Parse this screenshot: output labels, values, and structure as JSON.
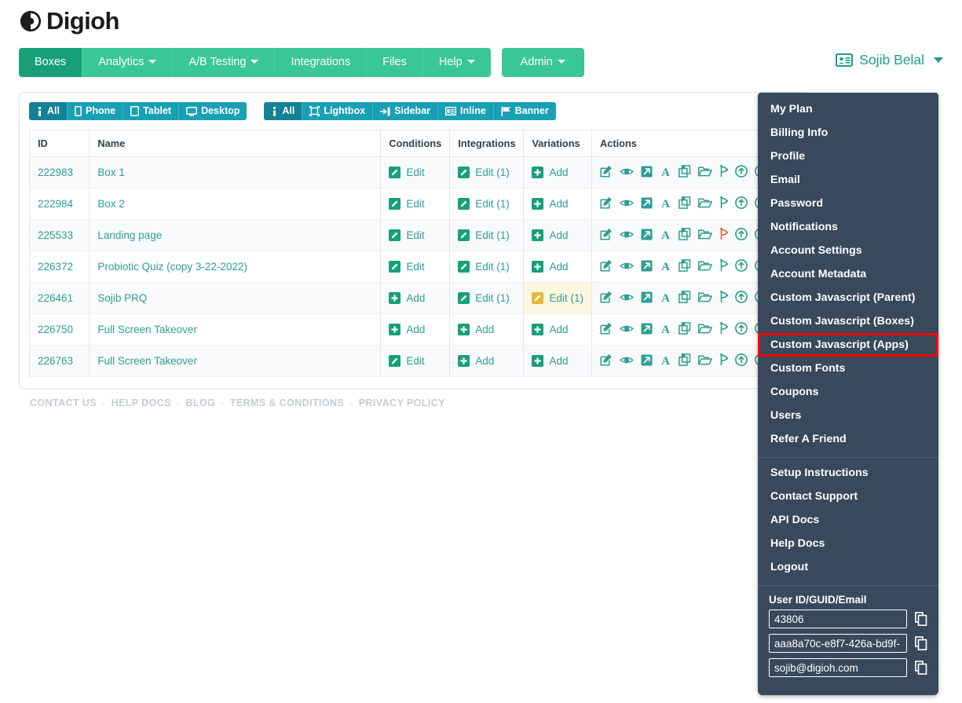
{
  "brand": {
    "name": "Digioh",
    "logo_icon": "digioh-shutter-logo"
  },
  "nav": {
    "items": [
      {
        "label": "Boxes",
        "active": true,
        "caret": false
      },
      {
        "label": "Analytics",
        "active": false,
        "caret": true
      },
      {
        "label": "A/B Testing",
        "active": false,
        "caret": true
      },
      {
        "label": "Integrations",
        "active": false,
        "caret": false
      },
      {
        "label": "Files",
        "active": false,
        "caret": false
      },
      {
        "label": "Help",
        "active": false,
        "caret": true
      }
    ],
    "admin": {
      "label": "Admin",
      "caret": true
    }
  },
  "user_menu": {
    "name": "Sojib Belal",
    "icon": "id-card-icon"
  },
  "filters": {
    "device": [
      {
        "label": "All",
        "icon": "info-icon",
        "active": true
      },
      {
        "label": "Phone",
        "icon": "phone-icon",
        "active": false
      },
      {
        "label": "Tablet",
        "icon": "tablet-icon",
        "active": false
      },
      {
        "label": "Desktop",
        "icon": "desktop-icon",
        "active": false
      }
    ],
    "type": [
      {
        "label": "All",
        "icon": "info-icon",
        "active": true
      },
      {
        "label": "Lightbox",
        "icon": "lightbox-icon",
        "active": false
      },
      {
        "label": "Sidebar",
        "icon": "sidebar-icon",
        "active": false
      },
      {
        "label": "Inline",
        "icon": "inline-icon",
        "active": false
      },
      {
        "label": "Banner",
        "icon": "banner-icon",
        "active": false
      }
    ],
    "add_button": {
      "icon": "plus-icon",
      "label": ""
    }
  },
  "table": {
    "columns": [
      "ID",
      "Name",
      "Conditions",
      "Integrations",
      "Variations",
      "Actions"
    ],
    "action_icons": [
      "edit-pencil-icon",
      "eye-preview-icon",
      "expand-arrow-icon",
      "font-a-icon",
      "copy-duplicate-icon",
      "folder-icon",
      "branch-icon",
      "arrow-up-circle-icon",
      "arrow-down-circle-icon",
      "pdf-icon"
    ],
    "rows": [
      {
        "id": "222983",
        "name": "Box 1",
        "conditions": {
          "label": "Edit",
          "icon": "pencil",
          "style": "green"
        },
        "integrations": {
          "label": "Edit (1)",
          "icon": "pencil",
          "style": "green"
        },
        "variations": {
          "label": "Add",
          "icon": "plus",
          "style": "green"
        },
        "highlight_variations": false,
        "branch_alert": false
      },
      {
        "id": "222984",
        "name": "Box 2",
        "conditions": {
          "label": "Edit",
          "icon": "pencil",
          "style": "green"
        },
        "integrations": {
          "label": "Edit (1)",
          "icon": "pencil",
          "style": "green"
        },
        "variations": {
          "label": "Add",
          "icon": "plus",
          "style": "green"
        },
        "highlight_variations": false,
        "branch_alert": false
      },
      {
        "id": "225533",
        "name": "Landing page",
        "conditions": {
          "label": "Edit",
          "icon": "pencil",
          "style": "green"
        },
        "integrations": {
          "label": "Edit (1)",
          "icon": "pencil",
          "style": "green"
        },
        "variations": {
          "label": "Add",
          "icon": "plus",
          "style": "green"
        },
        "highlight_variations": false,
        "branch_alert": true
      },
      {
        "id": "226372",
        "name": "Probiotic Quiz (copy 3-22-2022)",
        "conditions": {
          "label": "Edit",
          "icon": "pencil",
          "style": "green"
        },
        "integrations": {
          "label": "Edit (1)",
          "icon": "pencil",
          "style": "green"
        },
        "variations": {
          "label": "Add",
          "icon": "plus",
          "style": "green"
        },
        "highlight_variations": false,
        "branch_alert": false
      },
      {
        "id": "226461",
        "name": "Sojib PRQ",
        "conditions": {
          "label": "Add",
          "icon": "plus",
          "style": "green"
        },
        "integrations": {
          "label": "Edit (1)",
          "icon": "pencil",
          "style": "green"
        },
        "variations": {
          "label": "Edit (1)",
          "icon": "pencil",
          "style": "amber"
        },
        "highlight_variations": true,
        "branch_alert": false
      },
      {
        "id": "226750",
        "name": "Full Screen Takeover",
        "conditions": {
          "label": "Add",
          "icon": "plus",
          "style": "green"
        },
        "integrations": {
          "label": "Add",
          "icon": "plus",
          "style": "green"
        },
        "variations": {
          "label": "Add",
          "icon": "plus",
          "style": "green"
        },
        "highlight_variations": false,
        "branch_alert": false
      },
      {
        "id": "226763",
        "name": "Full Screen Takeover",
        "conditions": {
          "label": "Edit",
          "icon": "pencil",
          "style": "green"
        },
        "integrations": {
          "label": "Add",
          "icon": "plus",
          "style": "green"
        },
        "variations": {
          "label": "Add",
          "icon": "plus",
          "style": "green"
        },
        "highlight_variations": false,
        "branch_alert": false
      }
    ]
  },
  "footer": {
    "links": [
      "CONTACT US",
      "HELP DOCS",
      "BLOG",
      "TERMS & CONDITIONS",
      "PRIVACY POLICY"
    ],
    "separator": "-"
  },
  "dropdown": {
    "group1": [
      "My Plan",
      "Billing Info",
      "Profile",
      "Email",
      "Password",
      "Notifications",
      "Account Settings",
      "Account Metadata",
      "Custom Javascript (Parent)",
      "Custom Javascript (Boxes)",
      "Custom Javascript (Apps)",
      "Custom Fonts",
      "Coupons",
      "Users",
      "Refer A Friend"
    ],
    "highlighted_item": "Custom Javascript (Apps)",
    "highlight_color": "#ff0000",
    "group2": [
      "Setup Instructions",
      "Contact Support",
      "API Docs",
      "Help Docs",
      "Logout"
    ],
    "id_section": {
      "label": "User ID/GUID/Email",
      "fields": [
        {
          "value": "43806",
          "copy_icon": "copy-icon"
        },
        {
          "value": "aaa8a70c-e8f7-426a-bd9f-",
          "copy_icon": "copy-icon"
        },
        {
          "value": "sojib@digioh.com",
          "copy_icon": "copy-icon"
        }
      ]
    }
  },
  "colors": {
    "nav_green": "#3ac795",
    "nav_green_active": "#17a077",
    "filter_teal": "#1aa0b5",
    "filter_teal_active": "#138296",
    "link_teal": "#2e9e92",
    "dropdown_bg": "#38495c",
    "highlight_red": "#ff0000",
    "row_highlight_yellow": "#fcf8df",
    "pdf_orange": "#e8623a"
  }
}
